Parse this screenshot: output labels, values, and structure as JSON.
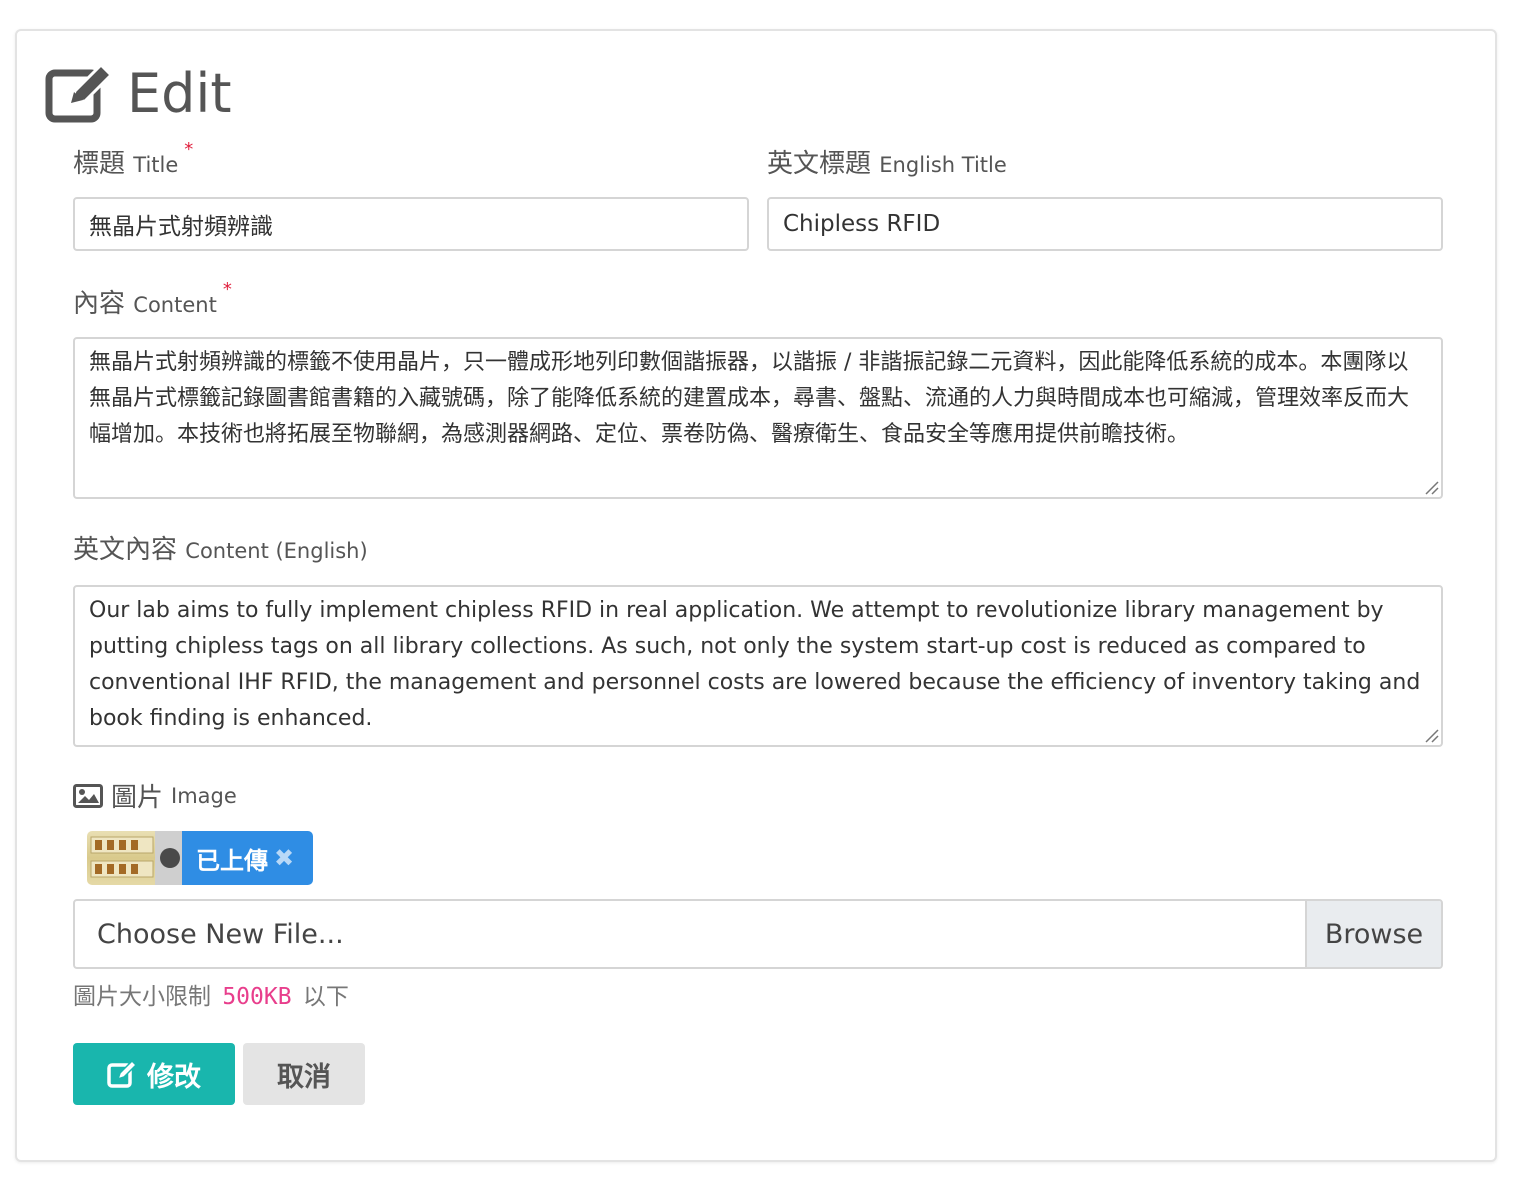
{
  "header": {
    "title": "Edit",
    "icon": "edit-icon"
  },
  "form": {
    "title_label_zh": "標題",
    "title_label_en": "Title",
    "required_mark": "*",
    "title_value": "無晶片式射頻辨識",
    "en_title_label_zh": "英文標題",
    "en_title_label_en": "English Title",
    "en_title_value": "Chipless RFID",
    "content_label_zh": "內容",
    "content_label_en": "Content",
    "content_value": "無晶片式射頻辨識的標籤不使用晶片，只一體成形地列印數個諧振器，以諧振 / 非諧振記錄二元資料，因此能降低系統的成本。本團隊以無晶片式標籤記錄圖書館書籍的入藏號碼，除了能降低系統的建置成本，尋書、盤點、流通的人力與時間成本也可縮減，管理效率反而大幅增加。本技術也將拓展至物聯網，為感測器網路、定位、票卷防偽、醫療衛生、食品安全等應用提供前瞻技術。",
    "en_content_label_zh": "英文內容",
    "en_content_label_en": "Content (English)",
    "en_content_value": "Our lab aims to fully implement chipless RFID in real application. We attempt to revolutionize library management by putting chipless tags on all library collections. As such, not only the system start-up cost is reduced as compared to conventional IHF RFID, the management and personnel costs are lowered because the efficiency of inventory taking and book finding is enhanced.",
    "image_label_zh": "圖片",
    "image_label_en": "Image",
    "uploaded_label": "已上傳",
    "remove_mark": "✖",
    "file_placeholder": "Choose New File...",
    "browse_label": "Browse",
    "hint_prefix": "圖片大小限制",
    "hint_size": "500KB",
    "hint_suffix": "以下"
  },
  "actions": {
    "save_label": "修改",
    "cancel_label": "取消"
  },
  "colors": {
    "primary": "#19b6ad",
    "chip": "#2f8de4",
    "required": "#e01f3d",
    "code": "#e83e8c"
  }
}
